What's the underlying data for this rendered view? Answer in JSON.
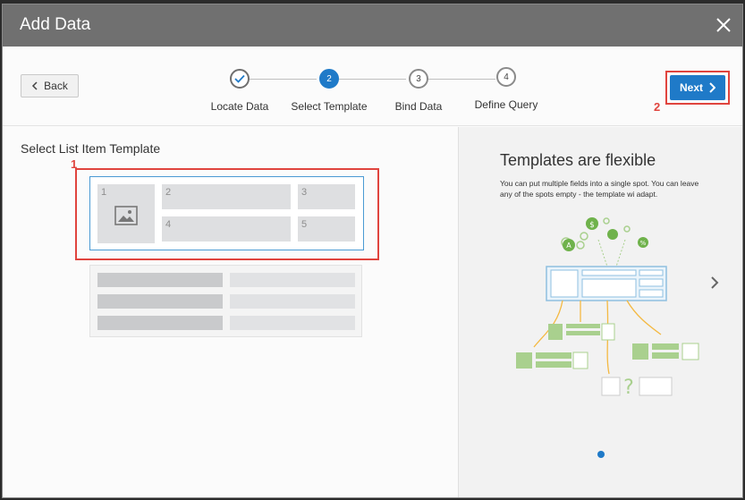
{
  "dialog": {
    "title": "Add Data",
    "close_icon": "close-icon"
  },
  "header": {
    "back_label": "Back",
    "next_label": "Next",
    "steps": [
      {
        "number": "",
        "label": "Locate Data",
        "state": "complete"
      },
      {
        "number": "2",
        "label": "Select Template",
        "state": "active"
      },
      {
        "number": "3",
        "label": "Bind Data",
        "state": "pending"
      },
      {
        "number": "4",
        "label": "Define Query",
        "state": "pending"
      }
    ]
  },
  "markers": {
    "template": "1",
    "next": "2"
  },
  "left_panel": {
    "title": "Select List Item Template",
    "template1_cells": [
      "1",
      "2",
      "3",
      "4",
      "5"
    ]
  },
  "right_panel": {
    "title": "Templates are flexible",
    "text": "You can put multiple fields into a single spot. You can leave any of the spots empty - the template wi adapt."
  },
  "colors": {
    "accent": "#1f7ac8",
    "highlight": "#e0443e",
    "illustration_green": "#a9d08e",
    "illustration_orange": "#f4b942",
    "illustration_blue": "#8fbfe0"
  }
}
